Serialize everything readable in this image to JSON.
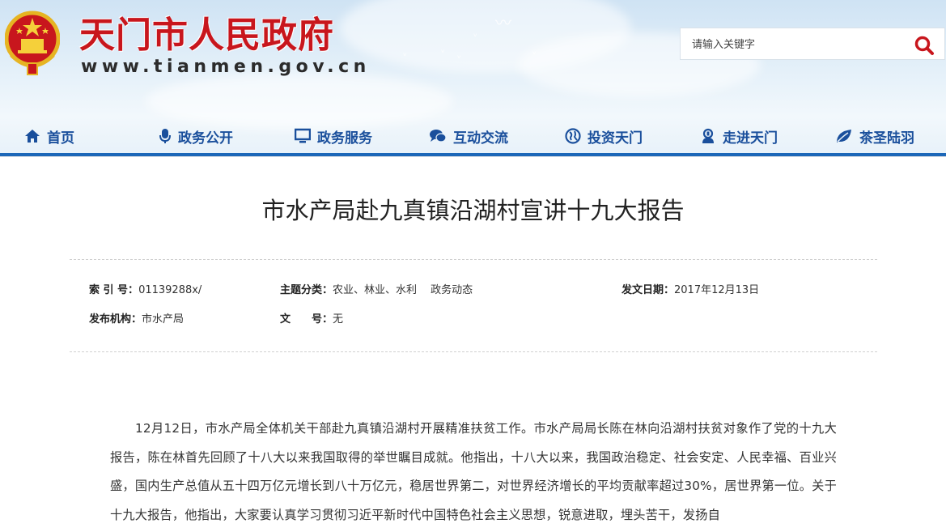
{
  "site": {
    "title": "天门市人民政府",
    "url": "www.tianmen.gov.cn"
  },
  "search": {
    "placeholder": "请输入关键字"
  },
  "nav": {
    "items": [
      {
        "label": "首页",
        "icon": "home-icon"
      },
      {
        "label": "政务公开",
        "icon": "microphone-icon"
      },
      {
        "label": "政务服务",
        "icon": "monitor-icon"
      },
      {
        "label": "互动交流",
        "icon": "chat-icon"
      },
      {
        "label": "投资天门",
        "icon": "globe-icon"
      },
      {
        "label": "走进天门",
        "icon": "person-badge-icon"
      },
      {
        "label": "茶圣陆羽",
        "icon": "leaf-icon"
      }
    ]
  },
  "article": {
    "title": "市水产局赴九真镇沿湖村宣讲十九大报告",
    "meta": {
      "index_label": "索 引 号：",
      "index_value": "01139288x/",
      "category_label": "主题分类：",
      "category_value": "农业、林业、水利　 政务动态",
      "date_label": "发文日期：",
      "date_value": "2017年12月13日",
      "publisher_label": "发布机构：",
      "publisher_value": "市水产局",
      "docno_label": "文　　号：",
      "docno_value": "无"
    },
    "body": "12月12日，市水产局全体机关干部赴九真镇沿湖村开展精准扶贫工作。市水产局局长陈在林向沿湖村扶贫对象作了党的十九大报告，陈在林首先回顾了十八大以来我国取得的举世瞩目成就。他指出，十八大以来，我国政治稳定、社会安定、人民幸福、百业兴盛，国内生产总值从五十四万亿元增长到八十万亿元，稳居世界第二，对世界经济增长的平均贡献率超过30%，居世界第一位。关于十九大报告，他指出，大家要认真学习贯彻习近平新时代中国特色社会主义思想，锐意进取，埋头苦干，发扬自"
  },
  "colors": {
    "title_red": "#c8161d",
    "nav_blue": "#1a4f9c",
    "nav_bar": "#1c67b8",
    "search_icon": "#c8161d"
  }
}
